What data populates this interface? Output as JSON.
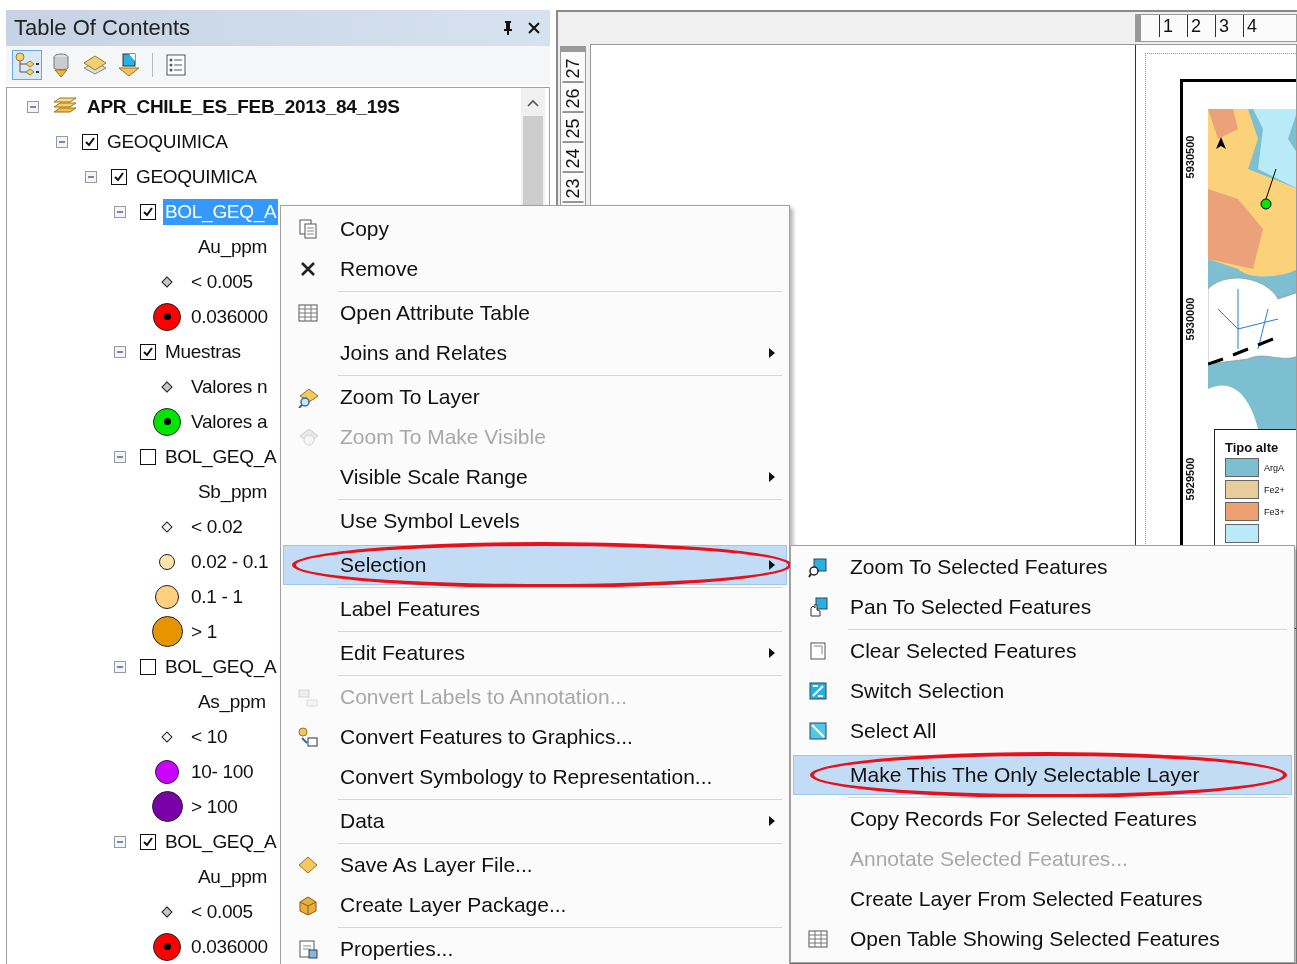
{
  "toc": {
    "title": "Table Of Contents",
    "toolbar": [
      {
        "selected": true
      },
      {
        "selected": false
      },
      {
        "selected": false
      },
      {
        "selected": false
      },
      {
        "selected": false
      }
    ],
    "tree": [
      {
        "label": "APR_CHILE_ES_FEB_2013_84_19S",
        "kind": "frame",
        "expanded": true,
        "selected": false,
        "children": [
          {
            "label": "GEOQUIMICA",
            "kind": "layer",
            "expanded": true,
            "checked": true,
            "selected": false,
            "children": [
              {
                "label": "GEOQUIMICA",
                "kind": "layer",
                "expanded": true,
                "checked": true,
                "selected": false,
                "children": [
                  {
                    "label": "BOL_GEQ_A",
                    "kind": "layer",
                    "expanded": true,
                    "checked": true,
                    "selected": true,
                    "children": [
                      {
                        "label": "Au_ppm",
                        "kind": "heading"
                      },
                      {
                        "label": "< 0.005",
                        "kind": "tiny",
                        "color": "#c8c8c8"
                      },
                      {
                        "label": "0.036000",
                        "kind": "target",
                        "color": "#ff0000"
                      }
                    ]
                  },
                  {
                    "label": "Muestras",
                    "kind": "layer",
                    "expanded": true,
                    "checked": true,
                    "selected": false,
                    "children": [
                      {
                        "label": "Valores n",
                        "kind": "tiny",
                        "color": "#c8c8c8"
                      },
                      {
                        "label": "Valores a",
                        "kind": "target",
                        "color": "#00e600"
                      }
                    ]
                  },
                  {
                    "label": "BOL_GEQ_A",
                    "kind": "layer",
                    "expanded": true,
                    "checked": false,
                    "selected": false,
                    "children": [
                      {
                        "label": "Sb_ppm",
                        "kind": "heading"
                      },
                      {
                        "label": "< 0.02",
                        "kind": "tiny",
                        "color": "#f4f4f4"
                      },
                      {
                        "label": "0.02 - 0.1",
                        "kind": "small",
                        "color": "#ffe4a8"
                      },
                      {
                        "label": "0.1 - 1",
                        "kind": "medium",
                        "color": "#ffd080"
                      },
                      {
                        "label": "> 1",
                        "kind": "large",
                        "color": "#e69500"
                      }
                    ]
                  },
                  {
                    "label": "BOL_GEQ_A",
                    "kind": "layer",
                    "expanded": true,
                    "checked": false,
                    "selected": false,
                    "children": [
                      {
                        "label": "As_ppm",
                        "kind": "heading"
                      },
                      {
                        "label": "< 10",
                        "kind": "tiny",
                        "color": "#f4f4f4"
                      },
                      {
                        "label": "10- 100",
                        "kind": "medium",
                        "color": "#cc00ff"
                      },
                      {
                        "label": "> 100",
                        "kind": "large",
                        "color": "#7a00a8"
                      }
                    ]
                  },
                  {
                    "label": "BOL_GEQ_A",
                    "kind": "layer",
                    "expanded": true,
                    "checked": true,
                    "selected": false,
                    "children": [
                      {
                        "label": "Au_ppm",
                        "kind": "heading"
                      },
                      {
                        "label": "< 0.005",
                        "kind": "tiny",
                        "color": "#c8c8c8"
                      },
                      {
                        "label": "0.036000",
                        "kind": "target",
                        "color": "#ff0000"
                      }
                    ]
                  }
                ]
              }
            ]
          }
        ]
      }
    ]
  },
  "layout_view": {
    "top_ruler": [
      "1",
      "2",
      "3",
      "4"
    ],
    "side_ruler": [
      "27",
      "26",
      "25",
      "24",
      "23"
    ],
    "map_ticks": [
      "5930500",
      "5930000",
      "5929500"
    ],
    "legend": {
      "title": "Tipo alte",
      "items": [
        {
          "label": "ArgA",
          "color": "#7bbfd0"
        },
        {
          "label": "Fe2+",
          "color": "#e8cc9c"
        },
        {
          "label": "Fe3+",
          "color": "#f0a070"
        },
        {
          "color": "#b8eaf8"
        }
      ]
    }
  },
  "context_menu": {
    "items": [
      {
        "label": "Copy",
        "disabled": false,
        "submenu": false,
        "selected": false,
        "separator_before": false
      },
      {
        "label": "Remove",
        "disabled": false,
        "submenu": false,
        "selected": false,
        "separator_before": false
      },
      {
        "label": "Open Attribute Table",
        "disabled": false,
        "submenu": false,
        "selected": false,
        "separator_before": true
      },
      {
        "label": "Joins and Relates",
        "disabled": false,
        "submenu": true,
        "selected": false,
        "separator_before": false
      },
      {
        "label": "Zoom To Layer",
        "disabled": false,
        "submenu": false,
        "selected": false,
        "separator_before": true
      },
      {
        "label": "Zoom To Make Visible",
        "disabled": true,
        "submenu": false,
        "selected": false,
        "separator_before": false
      },
      {
        "label": "Visible Scale Range",
        "disabled": false,
        "submenu": true,
        "selected": false,
        "separator_before": false
      },
      {
        "label": "Use Symbol Levels",
        "disabled": false,
        "submenu": false,
        "selected": false,
        "separator_before": true
      },
      {
        "label": "Selection",
        "disabled": false,
        "submenu": true,
        "selected": true,
        "separator_before": true
      },
      {
        "label": "Label Features",
        "disabled": false,
        "submenu": false,
        "selected": false,
        "separator_before": true
      },
      {
        "label": "Edit Features",
        "disabled": false,
        "submenu": true,
        "selected": false,
        "separator_before": true
      },
      {
        "label": "Convert Labels to Annotation...",
        "disabled": true,
        "submenu": false,
        "selected": false,
        "separator_before": true
      },
      {
        "label": "Convert Features to Graphics...",
        "disabled": false,
        "submenu": false,
        "selected": false,
        "separator_before": false
      },
      {
        "label": "Convert Symbology to Representation...",
        "disabled": false,
        "submenu": false,
        "selected": false,
        "separator_before": false
      },
      {
        "label": "Data",
        "disabled": false,
        "submenu": true,
        "selected": false,
        "separator_before": true
      },
      {
        "label": "Save As Layer File...",
        "disabled": false,
        "submenu": false,
        "selected": false,
        "separator_before": true
      },
      {
        "label": "Create Layer Package...",
        "disabled": false,
        "submenu": false,
        "selected": false,
        "separator_before": false
      },
      {
        "label": "Properties...",
        "disabled": false,
        "submenu": false,
        "selected": false,
        "separator_before": true
      }
    ]
  },
  "selection_submenu": {
    "items": [
      {
        "label": "Zoom To Selected Features",
        "disabled": false,
        "selected": false,
        "separator_before": false
      },
      {
        "label": "Pan To Selected Features",
        "disabled": false,
        "selected": false,
        "separator_before": false
      },
      {
        "label": "Clear Selected Features",
        "disabled": false,
        "selected": false,
        "separator_before": true
      },
      {
        "label": "Switch Selection",
        "disabled": false,
        "selected": false,
        "separator_before": false
      },
      {
        "label": "Select All",
        "disabled": false,
        "selected": false,
        "separator_before": false
      },
      {
        "label": "Make This The Only Selectable Layer",
        "disabled": false,
        "selected": true,
        "separator_before": true
      },
      {
        "label": "Copy Records For Selected Features",
        "disabled": false,
        "selected": false,
        "separator_before": true
      },
      {
        "label": "Annotate Selected Features...",
        "disabled": true,
        "selected": false,
        "separator_before": false
      },
      {
        "label": "Create Layer From Selected Features",
        "disabled": false,
        "selected": false,
        "separator_before": false
      },
      {
        "label": "Open Table Showing Selected Features",
        "disabled": false,
        "selected": false,
        "separator_before": false
      }
    ]
  }
}
